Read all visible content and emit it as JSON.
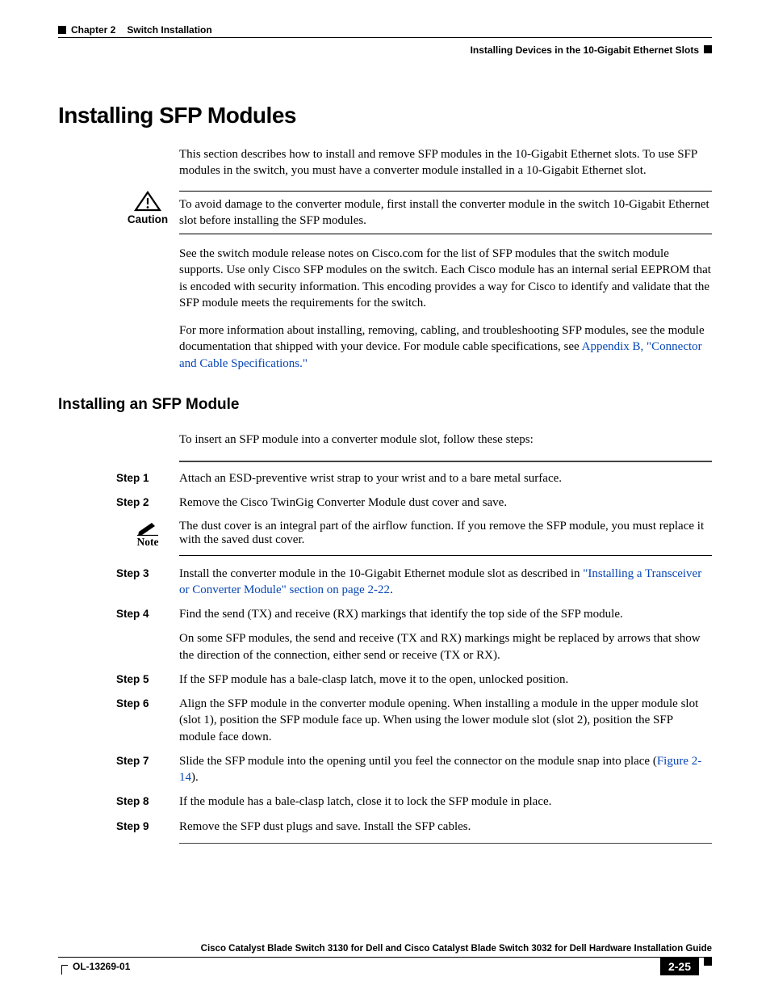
{
  "header": {
    "chapter": "Chapter 2",
    "chapter_title": "Switch Installation",
    "section_right": "Installing Devices in the 10-Gigabit Ethernet Slots"
  },
  "h1": "Installing SFP Modules",
  "intro": "This section describes how to install and remove SFP modules in the 10-Gigabit Ethernet slots. To use SFP modules in the switch, you must have a converter module installed in a 10-Gigabit Ethernet slot.",
  "caution": {
    "label": "Caution",
    "text": "To avoid damage to the converter module, first install the converter module in the switch 10-Gigabit Ethernet slot before installing the SFP modules."
  },
  "after_caution_p1": "See the switch module release notes on Cisco.com for the list of SFP modules that the switch module supports. Use only Cisco SFP modules on the switch. Each Cisco module has an internal serial EEPROM that is encoded with security information. This encoding provides a way for Cisco to identify and validate that the SFP module meets the requirements for the switch.",
  "after_caution_p2_pre": "For more information about installing, removing, cabling, and troubleshooting SFP modules, see the module documentation that shipped with your device. For module cable specifications, see ",
  "after_caution_p2_link": "Appendix B, \"Connector and Cable Specifications.\"",
  "h2": "Installing an SFP Module",
  "h2_intro": "To insert an SFP module into a converter module slot, follow these steps:",
  "steps": {
    "s1": {
      "label": "Step 1",
      "text": "Attach an ESD-preventive wrist strap to your wrist and to a bare metal surface."
    },
    "s2": {
      "label": "Step 2",
      "text": "Remove the Cisco TwinGig Converter Module dust cover and save."
    },
    "note": {
      "label": "Note",
      "text": "The dust cover is an integral part of the airflow function. If you remove the SFP module, you must replace it with the saved dust cover."
    },
    "s3": {
      "label": "Step 3",
      "pre": "Install the converter module in the 10-Gigabit Ethernet module slot as described in ",
      "link": "\"Installing a Transceiver or Converter Module\" section on page 2-22",
      "post": "."
    },
    "s4": {
      "label": "Step 4",
      "p1": "Find the send (TX) and receive (RX) markings that identify the top side of the SFP module.",
      "p2": "On some SFP modules, the send and receive (TX and RX) markings might be replaced by arrows that show the direction of the connection, either send or receive (TX or RX)."
    },
    "s5": {
      "label": "Step 5",
      "text": "If the SFP module has a bale-clasp latch, move it to the open, unlocked position."
    },
    "s6": {
      "label": "Step 6",
      "text": "Align the SFP module in the converter module opening. When installing a module in the upper module slot (slot 1), position the SFP module face up. When using the lower module slot (slot 2), position the SFP module face down."
    },
    "s7": {
      "label": "Step 7",
      "pre": "Slide the SFP module into the opening until you feel the connector on the module snap into place (",
      "link": "Figure 2-14",
      "post": ")."
    },
    "s8": {
      "label": "Step 8",
      "text": "If the module has a bale-clasp latch, close it to lock the SFP module in place."
    },
    "s9": {
      "label": "Step 9",
      "text": "Remove the SFP dust plugs and save. Install the SFP cables."
    }
  },
  "footer": {
    "title": "Cisco Catalyst Blade Switch 3130 for Dell and Cisco Catalyst Blade Switch 3032 for Dell Hardware Installation Guide",
    "doc_id": "OL-13269-01",
    "page": "2-25"
  }
}
